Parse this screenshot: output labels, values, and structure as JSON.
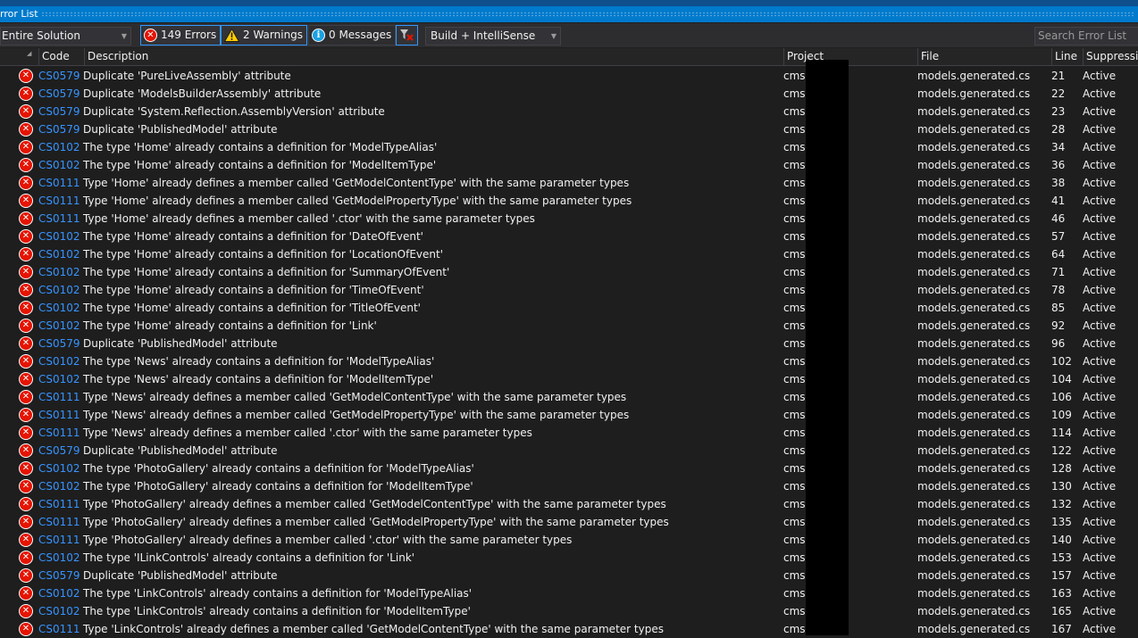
{
  "window": {
    "title": "rror List"
  },
  "toolbar": {
    "scope": "Entire Solution",
    "errors_label": "149 Errors",
    "warnings_label": "2 Warnings",
    "messages_label": "0 Messages",
    "build_filter": "Build + IntelliSense",
    "search_placeholder": "Search Error List"
  },
  "columns": {
    "code": "Code",
    "description": "Description",
    "project": "Project",
    "file": "File",
    "line": "Line",
    "suppression": "Suppressio"
  },
  "rows": [
    {
      "code": "CS0579",
      "desc": "Duplicate 'PureLiveAssembly' attribute",
      "project": "cms-",
      "file": "models.generated.cs",
      "line": "21",
      "supp": "Active"
    },
    {
      "code": "CS0579",
      "desc": "Duplicate 'ModelsBuilderAssembly' attribute",
      "project": "cms-",
      "file": "models.generated.cs",
      "line": "22",
      "supp": "Active"
    },
    {
      "code": "CS0579",
      "desc": "Duplicate 'System.Reflection.AssemblyVersion' attribute",
      "project": "cms-",
      "file": "models.generated.cs",
      "line": "23",
      "supp": "Active"
    },
    {
      "code": "CS0579",
      "desc": "Duplicate 'PublishedModel' attribute",
      "project": "cms-",
      "file": "models.generated.cs",
      "line": "28",
      "supp": "Active"
    },
    {
      "code": "CS0102",
      "desc": "The type 'Home' already contains a definition for 'ModelTypeAlias'",
      "project": "cms-",
      "file": "models.generated.cs",
      "line": "34",
      "supp": "Active"
    },
    {
      "code": "CS0102",
      "desc": "The type 'Home' already contains a definition for 'ModelItemType'",
      "project": "cms-",
      "file": "models.generated.cs",
      "line": "36",
      "supp": "Active"
    },
    {
      "code": "CS0111",
      "desc": "Type 'Home' already defines a member called 'GetModelContentType' with the same parameter types",
      "project": "cms-",
      "file": "models.generated.cs",
      "line": "38",
      "supp": "Active"
    },
    {
      "code": "CS0111",
      "desc": "Type 'Home' already defines a member called 'GetModelPropertyType' with the same parameter types",
      "project": "cms-",
      "file": "models.generated.cs",
      "line": "41",
      "supp": "Active"
    },
    {
      "code": "CS0111",
      "desc": "Type 'Home' already defines a member called '.ctor' with the same parameter types",
      "project": "cms-",
      "file": "models.generated.cs",
      "line": "46",
      "supp": "Active"
    },
    {
      "code": "CS0102",
      "desc": "The type 'Home' already contains a definition for 'DateOfEvent'",
      "project": "cms-",
      "file": "models.generated.cs",
      "line": "57",
      "supp": "Active"
    },
    {
      "code": "CS0102",
      "desc": "The type 'Home' already contains a definition for 'LocationOfEvent'",
      "project": "cms-",
      "file": "models.generated.cs",
      "line": "64",
      "supp": "Active"
    },
    {
      "code": "CS0102",
      "desc": "The type 'Home' already contains a definition for 'SummaryOfEvent'",
      "project": "cms-",
      "file": "models.generated.cs",
      "line": "71",
      "supp": "Active"
    },
    {
      "code": "CS0102",
      "desc": "The type 'Home' already contains a definition for 'TimeOfEvent'",
      "project": "cms-",
      "file": "models.generated.cs",
      "line": "78",
      "supp": "Active"
    },
    {
      "code": "CS0102",
      "desc": "The type 'Home' already contains a definition for 'TitleOfEvent'",
      "project": "cms-",
      "file": "models.generated.cs",
      "line": "85",
      "supp": "Active"
    },
    {
      "code": "CS0102",
      "desc": "The type 'Home' already contains a definition for 'Link'",
      "project": "cms-",
      "file": "models.generated.cs",
      "line": "92",
      "supp": "Active"
    },
    {
      "code": "CS0579",
      "desc": "Duplicate 'PublishedModel' attribute",
      "project": "cms-",
      "file": "models.generated.cs",
      "line": "96",
      "supp": "Active"
    },
    {
      "code": "CS0102",
      "desc": "The type 'News' already contains a definition for 'ModelTypeAlias'",
      "project": "cms-",
      "file": "models.generated.cs",
      "line": "102",
      "supp": "Active"
    },
    {
      "code": "CS0102",
      "desc": "The type 'News' already contains a definition for 'ModelItemType'",
      "project": "cms-",
      "file": "models.generated.cs",
      "line": "104",
      "supp": "Active"
    },
    {
      "code": "CS0111",
      "desc": "Type 'News' already defines a member called 'GetModelContentType' with the same parameter types",
      "project": "cms-",
      "file": "models.generated.cs",
      "line": "106",
      "supp": "Active"
    },
    {
      "code": "CS0111",
      "desc": "Type 'News' already defines a member called 'GetModelPropertyType' with the same parameter types",
      "project": "cms-",
      "file": "models.generated.cs",
      "line": "109",
      "supp": "Active"
    },
    {
      "code": "CS0111",
      "desc": "Type 'News' already defines a member called '.ctor' with the same parameter types",
      "project": "cms-",
      "file": "models.generated.cs",
      "line": "114",
      "supp": "Active"
    },
    {
      "code": "CS0579",
      "desc": "Duplicate 'PublishedModel' attribute",
      "project": "cms-",
      "file": "models.generated.cs",
      "line": "122",
      "supp": "Active"
    },
    {
      "code": "CS0102",
      "desc": "The type 'PhotoGallery' already contains a definition for 'ModelTypeAlias'",
      "project": "cms-",
      "file": "models.generated.cs",
      "line": "128",
      "supp": "Active"
    },
    {
      "code": "CS0102",
      "desc": "The type 'PhotoGallery' already contains a definition for 'ModelItemType'",
      "project": "cms-",
      "file": "models.generated.cs",
      "line": "130",
      "supp": "Active"
    },
    {
      "code": "CS0111",
      "desc": "Type 'PhotoGallery' already defines a member called 'GetModelContentType' with the same parameter types",
      "project": "cms-",
      "file": "models.generated.cs",
      "line": "132",
      "supp": "Active"
    },
    {
      "code": "CS0111",
      "desc": "Type 'PhotoGallery' already defines a member called 'GetModelPropertyType' with the same parameter types",
      "project": "cms-",
      "file": "models.generated.cs",
      "line": "135",
      "supp": "Active"
    },
    {
      "code": "CS0111",
      "desc": "Type 'PhotoGallery' already defines a member called '.ctor' with the same parameter types",
      "project": "cms-",
      "file": "models.generated.cs",
      "line": "140",
      "supp": "Active"
    },
    {
      "code": "CS0102",
      "desc": "The type 'ILinkControls' already contains a definition for 'Link'",
      "project": "cms-",
      "file": "models.generated.cs",
      "line": "153",
      "supp": "Active"
    },
    {
      "code": "CS0579",
      "desc": "Duplicate 'PublishedModel' attribute",
      "project": "cms-",
      "file": "models.generated.cs",
      "line": "157",
      "supp": "Active"
    },
    {
      "code": "CS0102",
      "desc": "The type 'LinkControls' already contains a definition for 'ModelTypeAlias'",
      "project": "cms-",
      "file": "models.generated.cs",
      "line": "163",
      "supp": "Active"
    },
    {
      "code": "CS0102",
      "desc": "The type 'LinkControls' already contains a definition for 'ModelItemType'",
      "project": "cms-",
      "file": "models.generated.cs",
      "line": "165",
      "supp": "Active"
    },
    {
      "code": "CS0111",
      "desc": "Type 'LinkControls' already defines a member called 'GetModelContentType' with the same parameter types",
      "project": "cms-",
      "file": "models.generated.cs",
      "line": "167",
      "supp": "Active"
    }
  ]
}
